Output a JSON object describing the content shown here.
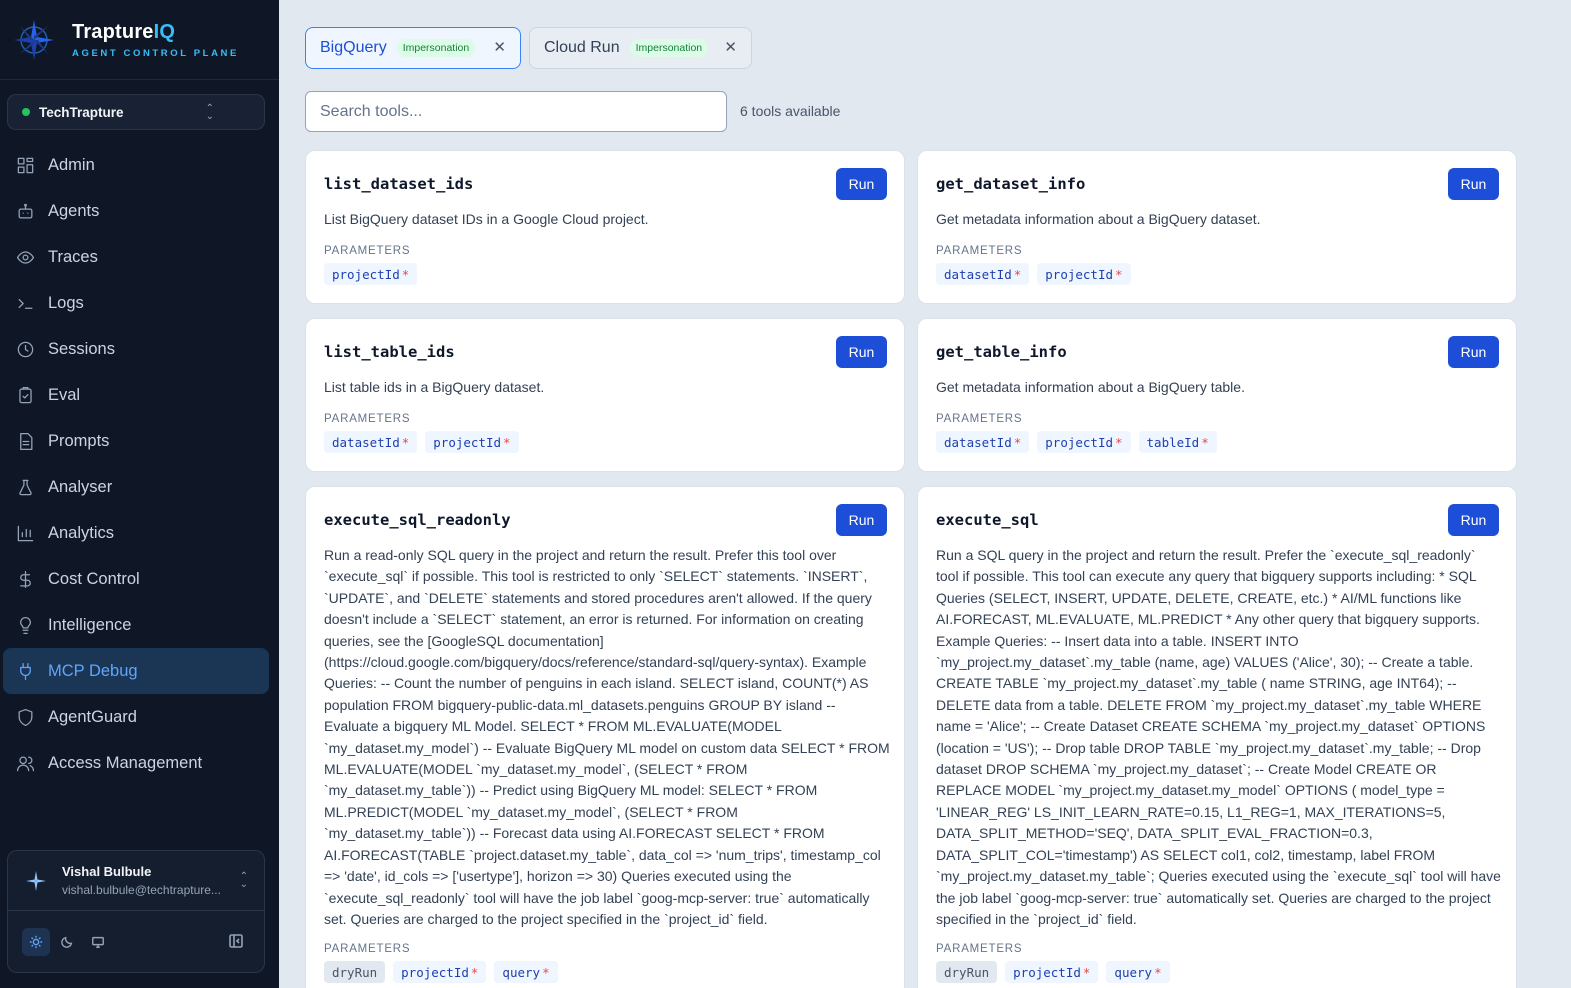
{
  "brand": {
    "name_main": "Trapture",
    "name_accent": "IQ",
    "subtitle": "AGENT CONTROL PLANE"
  },
  "org": {
    "name": "TechTrapture"
  },
  "nav": {
    "items": [
      {
        "label": "Admin",
        "icon": "dashboard-icon"
      },
      {
        "label": "Agents",
        "icon": "bot-icon"
      },
      {
        "label": "Traces",
        "icon": "eye-icon"
      },
      {
        "label": "Logs",
        "icon": "terminal-icon"
      },
      {
        "label": "Sessions",
        "icon": "clock-icon"
      },
      {
        "label": "Eval",
        "icon": "clipboard-check-icon"
      },
      {
        "label": "Prompts",
        "icon": "document-icon"
      },
      {
        "label": "Analyser",
        "icon": "flask-icon"
      },
      {
        "label": "Analytics",
        "icon": "bar-chart-icon"
      },
      {
        "label": "Cost Control",
        "icon": "dollar-icon"
      },
      {
        "label": "Intelligence",
        "icon": "lightbulb-icon"
      },
      {
        "label": "MCP Debug",
        "icon": "plug-icon",
        "active": true
      },
      {
        "label": "AgentGuard",
        "icon": "shield-icon"
      },
      {
        "label": "Access Management",
        "icon": "users-icon"
      }
    ]
  },
  "user": {
    "name": "Vishal Bulbule",
    "email": "vishal.bulbule@techtrapture..."
  },
  "tabs": [
    {
      "label": "BigQuery",
      "badge": "Impersonation",
      "active": true
    },
    {
      "label": "Cloud Run",
      "badge": "Impersonation",
      "active": false
    }
  ],
  "search": {
    "placeholder": "Search tools..."
  },
  "tools_count": "6 tools available",
  "params_label": "PARAMETERS",
  "run_label": "Run",
  "tools": [
    {
      "name": "list_dataset_ids",
      "description": "List BigQuery dataset IDs in a Google Cloud project.",
      "params": [
        {
          "name": "projectId",
          "required": true
        }
      ]
    },
    {
      "name": "get_dataset_info",
      "description": "Get metadata information about a BigQuery dataset.",
      "params": [
        {
          "name": "datasetId",
          "required": true
        },
        {
          "name": "projectId",
          "required": true
        }
      ]
    },
    {
      "name": "list_table_ids",
      "description": "List table ids in a BigQuery dataset.",
      "params": [
        {
          "name": "datasetId",
          "required": true
        },
        {
          "name": "projectId",
          "required": true
        }
      ]
    },
    {
      "name": "get_table_info",
      "description": "Get metadata information about a BigQuery table.",
      "params": [
        {
          "name": "datasetId",
          "required": true
        },
        {
          "name": "projectId",
          "required": true
        },
        {
          "name": "tableId",
          "required": true
        }
      ]
    },
    {
      "name": "execute_sql_readonly",
      "description": "Run a read-only SQL query in the project and return the result. Prefer this tool over `execute_sql` if possible. This tool is restricted to only `SELECT` statements. `INSERT`, `UPDATE`, and `DELETE` statements and stored procedures aren't allowed. If the query doesn't include a `SELECT` statement, an error is returned. For information on creating queries, see the [GoogleSQL documentation](https://cloud.google.com/bigquery/docs/reference/standard-sql/query-syntax). Example Queries: -- Count the number of penguins in each island. SELECT island, COUNT(*) AS population FROM bigquery-public-data.ml_datasets.penguins GROUP BY island -- Evaluate a bigquery ML Model. SELECT * FROM ML.EVALUATE(MODEL `my_dataset.my_model`) -- Evaluate BigQuery ML model on custom data SELECT * FROM ML.EVALUATE(MODEL `my_dataset.my_model`, (SELECT * FROM `my_dataset.my_table`)) -- Predict using BigQuery ML model: SELECT * FROM ML.PREDICT(MODEL `my_dataset.my_model`, (SELECT * FROM `my_dataset.my_table`)) -- Forecast data using AI.FORECAST SELECT * FROM AI.FORECAST(TABLE `project.dataset.my_table`, data_col => 'num_trips', timestamp_col => 'date', id_cols => ['usertype'], horizon => 30) Queries executed using the `execute_sql_readonly` tool will have the job label `goog-mcp-server: true` automatically set. Queries are charged to the project specified in the `project_id` field.",
      "params": [
        {
          "name": "dryRun",
          "required": false
        },
        {
          "name": "projectId",
          "required": true
        },
        {
          "name": "query",
          "required": true
        }
      ]
    },
    {
      "name": "execute_sql",
      "description": "Run a SQL query in the project and return the result. Prefer the `execute_sql_readonly` tool if possible. This tool can execute any query that bigquery supports including: * SQL Queries (SELECT, INSERT, UPDATE, DELETE, CREATE, etc.) * AI/ML functions like AI.FORECAST, ML.EVALUATE, ML.PREDICT * Any other query that bigquery supports. Example Queries: -- Insert data into a table. INSERT INTO `my_project.my_dataset`.my_table (name, age) VALUES ('Alice', 30); -- Create a table. CREATE TABLE `my_project.my_dataset`.my_table ( name STRING, age INT64); -- DELETE data from a table. DELETE FROM `my_project.my_dataset`.my_table WHERE name = 'Alice'; -- Create Dataset CREATE SCHEMA `my_project.my_dataset` OPTIONS (location = 'US'); -- Drop table DROP TABLE `my_project.my_dataset`.my_table; -- Drop dataset DROP SCHEMA `my_project.my_dataset`; -- Create Model CREATE OR REPLACE MODEL `my_project.my_dataset.my_model` OPTIONS ( model_type = 'LINEAR_REG' LS_INIT_LEARN_RATE=0.15, L1_REG=1, MAX_ITERATIONS=5, DATA_SPLIT_METHOD='SEQ', DATA_SPLIT_EVAL_FRACTION=0.3, DATA_SPLIT_COL='timestamp') AS SELECT col1, col2, timestamp, label FROM `my_project.my_dataset.my_table`; Queries executed using the `execute_sql` tool will have the job label `goog-mcp-server: true` automatically set. Queries are charged to the project specified in the `project_id` field.",
      "params": [
        {
          "name": "dryRun",
          "required": false
        },
        {
          "name": "projectId",
          "required": true
        },
        {
          "name": "query",
          "required": true
        }
      ]
    }
  ]
}
